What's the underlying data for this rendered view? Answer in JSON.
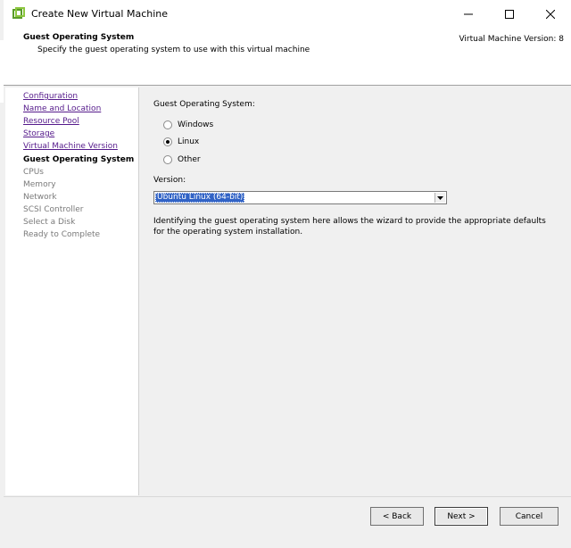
{
  "window": {
    "title": "Create New Virtual Machine"
  },
  "header": {
    "title": "Guest Operating System",
    "subtitle": "Specify the guest operating system to use with this virtual machine",
    "version": "Virtual Machine Version: 8"
  },
  "sidebar": {
    "items": [
      {
        "label": "Configuration",
        "state": "link"
      },
      {
        "label": "Name and Location",
        "state": "link"
      },
      {
        "label": "Resource Pool",
        "state": "link"
      },
      {
        "label": "Storage",
        "state": "link"
      },
      {
        "label": "Virtual Machine Version",
        "state": "link"
      },
      {
        "label": "Guest Operating System",
        "state": "current"
      },
      {
        "label": "CPUs",
        "state": "disabled"
      },
      {
        "label": "Memory",
        "state": "disabled"
      },
      {
        "label": "Network",
        "state": "disabled"
      },
      {
        "label": "SCSI Controller",
        "state": "disabled"
      },
      {
        "label": "Select a Disk",
        "state": "disabled"
      },
      {
        "label": "Ready to Complete",
        "state": "disabled"
      }
    ]
  },
  "main": {
    "os_label": "Guest Operating System:",
    "os_options": [
      {
        "label": "Windows",
        "checked": false
      },
      {
        "label": "Linux",
        "checked": true
      },
      {
        "label": "Other",
        "checked": false
      }
    ],
    "version_label": "Version:",
    "version_value": "Ubuntu Linux (64-bit)",
    "description": "Identifying the guest operating system here allows the wizard to provide the appropriate defaults for the operating system installation."
  },
  "buttons": {
    "back": "< Back",
    "next": "Next >",
    "cancel": "Cancel"
  },
  "colors": {
    "selection": "#3163c6",
    "link": "#551a8b"
  }
}
